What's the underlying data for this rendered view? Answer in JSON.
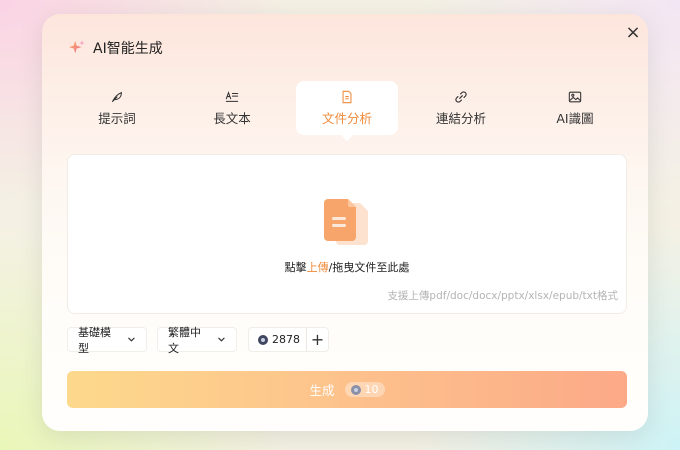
{
  "dialog": {
    "title": "AI智能生成",
    "close_icon": "×"
  },
  "tabs": [
    {
      "label": "提示詞",
      "icon": "feather-icon"
    },
    {
      "label": "長文本",
      "icon": "text-icon"
    },
    {
      "label": "文件分析",
      "icon": "document-icon",
      "active": true
    },
    {
      "label": "連結分析",
      "icon": "link-icon"
    },
    {
      "label": "AI識圖",
      "icon": "image-icon"
    }
  ],
  "upload": {
    "hint_prefix": "點擊",
    "hint_accent": "上傳",
    "hint_suffix": "/拖曳文件至此處",
    "formats": "支援上傳pdf/doc/docx/pptx/xlsx/epub/txt格式"
  },
  "controls": {
    "model": "基礎模型",
    "language": "繁體中文",
    "credits": "2878",
    "add_label": "+"
  },
  "generate": {
    "label": "生成",
    "cost": "10"
  },
  "colors": {
    "accent": "#f08a3a",
    "button_start": "#fdd98c",
    "button_end": "#fca987"
  }
}
